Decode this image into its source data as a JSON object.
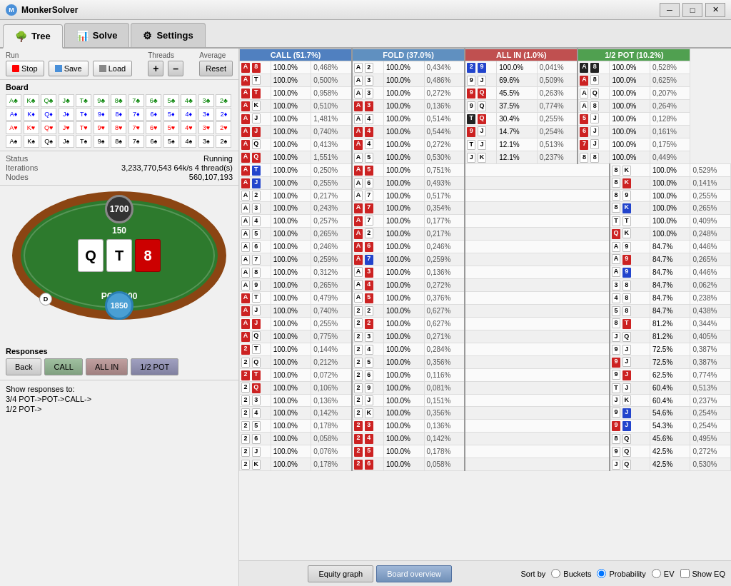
{
  "app": {
    "title": "MonkerSolver",
    "titlebar_icon": "M"
  },
  "tabs": [
    {
      "label": "Tree",
      "icon": "🌳",
      "active": true
    },
    {
      "label": "Solve",
      "icon": "📊",
      "active": false
    },
    {
      "label": "Settings",
      "icon": "⚙",
      "active": false
    }
  ],
  "run": {
    "label": "Run",
    "stop_label": "Stop",
    "save_label": "Save",
    "load_label": "Load",
    "threads_label": "Threads",
    "average_label": "Average",
    "reset_label": "Reset"
  },
  "board_label": "Board",
  "status": {
    "label": "Status",
    "running": "Running",
    "iterations_label": "Iterations",
    "iterations_value": "3,233,770,543  64k/s 4 thread(s)",
    "nodes_label": "Nodes",
    "nodes_value": "560,107,193"
  },
  "table": {
    "chip_top": "1700",
    "bet_middle": "150",
    "cards": [
      "Q",
      "T",
      "8"
    ],
    "pot": "POT: 300",
    "dealer": "D",
    "chip_bottom": "1850"
  },
  "responses": {
    "label": "Responses",
    "back_label": "Back",
    "call_label": "CALL",
    "allin_label": "ALL IN",
    "halfpot_label": "1/2 POT"
  },
  "show_responses_label": "Show responses to:",
  "show_responses_lines": [
    "3/4 POT->POT->CALL->",
    "1/2 POT->"
  ],
  "columns": {
    "call_header": "CALL (51.7%)",
    "fold_header": "FOLD (37.0%)",
    "allin_header": "ALL IN (1.0%)",
    "halfpot_header": "1/2 POT (10.2%)"
  },
  "strategy_rows": [
    {
      "h1": "A",
      "h1c": "red",
      "h2": "8",
      "h2c": "red",
      "cp": "100.0%",
      "cev": "0,468%",
      "h3": "A",
      "h3c": "white",
      "h4": "2",
      "h4c": "white",
      "fp": "100.0%",
      "fev": "0,434%",
      "h5": "2",
      "h5c": "blue",
      "h6": "9",
      "h6c": "blue",
      "ap": "100.0%",
      "aev": "0,041%",
      "h7": "A",
      "h7c": "black",
      "h8": "8",
      "h8c": "black",
      "hp": "100.0%",
      "hev": "0,528%"
    },
    {
      "h1": "A",
      "h1c": "red",
      "h2": "T",
      "h2c": "white",
      "cp": "100.0%",
      "cev": "0,500%",
      "h3": "A",
      "h3c": "white",
      "h4": "3",
      "h4c": "white",
      "fp": "100.0%",
      "fev": "0,486%",
      "h5": "9",
      "h5c": "white",
      "h6": "J",
      "h6c": "white",
      "ap": "69.6%",
      "aev": "0,509%",
      "h7": "A",
      "h7c": "red",
      "h8": "8",
      "h8c": "white",
      "hp": "100.0%",
      "hev": "0,625%"
    },
    {
      "h1": "A",
      "h1c": "red",
      "h2": "T",
      "h2c": "red",
      "cp": "100.0%",
      "cev": "0,958%",
      "h3": "A",
      "h3c": "white",
      "h4": "3",
      "h4c": "white",
      "fp": "100.0%",
      "fev": "0,272%",
      "h5": "9",
      "h5c": "red",
      "h6": "Q",
      "h6c": "red",
      "ap": "45.5%",
      "aev": "0,263%",
      "h7": "A",
      "h7c": "white",
      "h8": "Q",
      "h8c": "white",
      "hp": "100.0%",
      "hev": "0,207%"
    },
    {
      "h1": "A",
      "h1c": "red",
      "h2": "K",
      "h2c": "white",
      "cp": "100.0%",
      "cev": "0,510%",
      "h3": "A",
      "h3c": "red",
      "h4": "3",
      "h4c": "red",
      "fp": "100.0%",
      "fev": "0,136%",
      "h5": "9",
      "h5c": "white",
      "h6": "Q",
      "h6c": "white",
      "ap": "37.5%",
      "aev": "0,774%",
      "h7": "A",
      "h7c": "white",
      "h8": "8",
      "h8c": "white",
      "hp": "100.0%",
      "hev": "0,264%"
    },
    {
      "h1": "A",
      "h1c": "red",
      "h2": "J",
      "h2c": "white",
      "cp": "100.0%",
      "cev": "1,481%",
      "h3": "A",
      "h3c": "white",
      "h4": "4",
      "h4c": "white",
      "fp": "100.0%",
      "fev": "0,514%",
      "h5": "T",
      "h5c": "black",
      "h6": "Q",
      "h6c": "red",
      "ap": "30.4%",
      "aev": "0,255%",
      "h7": "5",
      "h7c": "red",
      "h8": "J",
      "h8c": "white",
      "hp": "100.0%",
      "hev": "0,128%"
    },
    {
      "h1": "A",
      "h1c": "red",
      "h2": "J",
      "h2c": "red",
      "cp": "100.0%",
      "cev": "0,740%",
      "h3": "A",
      "h3c": "red",
      "h4": "4",
      "h4c": "red",
      "fp": "100.0%",
      "fev": "0,544%",
      "h5": "9",
      "h5c": "red",
      "h6": "J",
      "h6c": "white",
      "ap": "14.7%",
      "aev": "0,254%",
      "h7": "6",
      "h7c": "red",
      "h8": "J",
      "h8c": "white",
      "hp": "100.0%",
      "hev": "0,161%"
    },
    {
      "h1": "A",
      "h1c": "red",
      "h2": "Q",
      "h2c": "white",
      "cp": "100.0%",
      "cev": "0,413%",
      "h3": "A",
      "h3c": "red",
      "h4": "4",
      "h4c": "white",
      "fp": "100.0%",
      "fev": "0,272%",
      "h5": "T",
      "h5c": "white",
      "h6": "J",
      "h6c": "white",
      "ap": "12.1%",
      "aev": "0,513%",
      "h7": "7",
      "h7c": "red",
      "h8": "J",
      "h8c": "white",
      "hp": "100.0%",
      "hev": "0,175%"
    },
    {
      "h1": "A",
      "h1c": "red",
      "h2": "Q",
      "h2c": "red",
      "cp": "100.0%",
      "cev": "1,551%",
      "h3": "A",
      "h3c": "white",
      "h4": "5",
      "h4c": "white",
      "fp": "100.0%",
      "fev": "0,530%",
      "h5": "J",
      "h5c": "white",
      "h6": "K",
      "h6c": "white",
      "ap": "12.1%",
      "aev": "0,237%",
      "h7": "8",
      "h7c": "white",
      "h8": "8",
      "h8c": "white",
      "hp": "100.0%",
      "hev": "0,449%"
    },
    {
      "h1": "A",
      "h1c": "red",
      "h2": "T",
      "h2c": "blue",
      "cp": "100.0%",
      "cev": "0,250%",
      "h3": "A",
      "h3c": "red",
      "h4": "5",
      "h4c": "red",
      "fp": "100.0%",
      "fev": "0,751%",
      "h5": "",
      "h5c": "",
      "h6": "",
      "h6c": "",
      "ap": "",
      "aev": "",
      "h7": "8",
      "h7c": "white",
      "h8": "K",
      "h8c": "white",
      "hp": "100.0%",
      "hev": "0,529%"
    },
    {
      "h1": "A",
      "h1c": "red",
      "h2": "J",
      "h2c": "blue",
      "cp": "100.0%",
      "cev": "0,255%",
      "h3": "A",
      "h3c": "white",
      "h4": "6",
      "h4c": "white",
      "fp": "100.0%",
      "fev": "0,493%",
      "h5": "",
      "h5c": "",
      "h6": "",
      "h6c": "",
      "ap": "",
      "aev": "",
      "h7": "8",
      "h7c": "white",
      "h8": "K",
      "h8c": "red",
      "hp": "100.0%",
      "hev": "0,141%"
    },
    {
      "h1": "A",
      "h1c": "white",
      "h2": "2",
      "h2c": "white",
      "cp": "100.0%",
      "cev": "0,217%",
      "h3": "A",
      "h3c": "white",
      "h4": "7",
      "h4c": "white",
      "fp": "100.0%",
      "fev": "0,517%",
      "h5": "",
      "h5c": "",
      "h6": "",
      "h6c": "",
      "ap": "",
      "aev": "",
      "h7": "8",
      "h7c": "white",
      "h8": "9",
      "h8c": "white",
      "hp": "100.0%",
      "hev": "0,255%"
    },
    {
      "h1": "A",
      "h1c": "white",
      "h2": "3",
      "h2c": "white",
      "cp": "100.0%",
      "cev": "0,243%",
      "h3": "A",
      "h3c": "red",
      "h4": "7",
      "h4c": "red",
      "fp": "100.0%",
      "fev": "0,354%",
      "h5": "",
      "h5c": "",
      "h6": "",
      "h6c": "",
      "ap": "",
      "aev": "",
      "h7": "8",
      "h7c": "white",
      "h8": "K",
      "h8c": "blue",
      "hp": "100.0%",
      "hev": "0,265%"
    },
    {
      "h1": "A",
      "h1c": "white",
      "h2": "4",
      "h2c": "white",
      "cp": "100.0%",
      "cev": "0,257%",
      "h3": "A",
      "h3c": "red",
      "h4": "7",
      "h4c": "white",
      "fp": "100.0%",
      "fev": "0,177%",
      "h5": "",
      "h5c": "",
      "h6": "",
      "h6c": "",
      "ap": "",
      "aev": "",
      "h7": "T",
      "h7c": "white",
      "h8": "T",
      "h8c": "white",
      "hp": "100.0%",
      "hev": "0,409%"
    },
    {
      "h1": "A",
      "h1c": "white",
      "h2": "5",
      "h2c": "white",
      "cp": "100.0%",
      "cev": "0,265%",
      "h3": "A",
      "h3c": "red",
      "h4": "2",
      "h4c": "white",
      "fp": "100.0%",
      "fev": "0,217%",
      "h5": "",
      "h5c": "",
      "h6": "",
      "h6c": "",
      "ap": "",
      "aev": "",
      "h7": "Q",
      "h7c": "red",
      "h8": "K",
      "h8c": "white",
      "hp": "100.0%",
      "hev": "0,248%"
    },
    {
      "h1": "A",
      "h1c": "white",
      "h2": "6",
      "h2c": "white",
      "cp": "100.0%",
      "cev": "0,246%",
      "h3": "A",
      "h3c": "red",
      "h4": "6",
      "h4c": "red",
      "fp": "100.0%",
      "fev": "0,246%",
      "h5": "",
      "h5c": "",
      "h6": "",
      "h6c": "",
      "ap": "",
      "aev": "",
      "h7": "A",
      "h7c": "white",
      "h8": "9",
      "h8c": "white",
      "hp": "84.7%",
      "hev": "0,446%"
    },
    {
      "h1": "A",
      "h1c": "white",
      "h2": "7",
      "h2c": "white",
      "cp": "100.0%",
      "cev": "0,259%",
      "h3": "A",
      "h3c": "red",
      "h4": "7",
      "h4c": "blue",
      "fp": "100.0%",
      "fev": "0,259%",
      "h5": "",
      "h5c": "",
      "h6": "",
      "h6c": "",
      "ap": "",
      "aev": "",
      "h7": "A",
      "h7c": "white",
      "h8": "9",
      "h8c": "red",
      "hp": "84.7%",
      "hev": "0,265%"
    },
    {
      "h1": "A",
      "h1c": "white",
      "h2": "8",
      "h2c": "white",
      "cp": "100.0%",
      "cev": "0,312%",
      "h3": "A",
      "h3c": "white",
      "h4": "3",
      "h4c": "red",
      "fp": "100.0%",
      "fev": "0,136%",
      "h5": "",
      "h5c": "",
      "h6": "",
      "h6c": "",
      "ap": "",
      "aev": "",
      "h7": "A",
      "h7c": "white",
      "h8": "9",
      "h8c": "blue",
      "hp": "84.7%",
      "hev": "0,446%"
    },
    {
      "h1": "A",
      "h1c": "white",
      "h2": "9",
      "h2c": "white",
      "cp": "100.0%",
      "cev": "0,265%",
      "h3": "A",
      "h3c": "white",
      "h4": "4",
      "h4c": "red",
      "fp": "100.0%",
      "fev": "0,272%",
      "h5": "",
      "h5c": "",
      "h6": "",
      "h6c": "",
      "ap": "",
      "aev": "",
      "h7": "3",
      "h7c": "white",
      "h8": "8",
      "h8c": "white",
      "hp": "84.7%",
      "hev": "0,062%"
    },
    {
      "h1": "A",
      "h1c": "red",
      "h2": "T",
      "h2c": "white",
      "cp": "100.0%",
      "cev": "0,479%",
      "h3": "A",
      "h3c": "white",
      "h4": "5",
      "h4c": "red",
      "fp": "100.0%",
      "fev": "0,376%",
      "h5": "",
      "h5c": "",
      "h6": "",
      "h6c": "",
      "ap": "",
      "aev": "",
      "h7": "4",
      "h7c": "white",
      "h8": "8",
      "h8c": "white",
      "hp": "84.7%",
      "hev": "0,238%"
    },
    {
      "h1": "A",
      "h1c": "red",
      "h2": "J",
      "h2c": "white",
      "cp": "100.0%",
      "cev": "0,740%",
      "h3": "2",
      "h3c": "white",
      "h4": "2",
      "h4c": "white",
      "fp": "100.0%",
      "fev": "0,627%",
      "h5": "",
      "h5c": "",
      "h6": "",
      "h6c": "",
      "ap": "",
      "aev": "",
      "h7": "5",
      "h7c": "white",
      "h8": "8",
      "h8c": "white",
      "hp": "84.7%",
      "hev": "0,438%"
    },
    {
      "h1": "A",
      "h1c": "red",
      "h2": "J",
      "h2c": "red",
      "cp": "100.0%",
      "cev": "0,255%",
      "h3": "2",
      "h3c": "white",
      "h4": "2",
      "h4c": "red",
      "fp": "100.0%",
      "fev": "0,627%",
      "h5": "",
      "h5c": "",
      "h6": "",
      "h6c": "",
      "ap": "",
      "aev": "",
      "h7": "8",
      "h7c": "white",
      "h8": "T",
      "h8c": "red",
      "hp": "81.2%",
      "hev": "0,344%"
    },
    {
      "h1": "A",
      "h1c": "red",
      "h2": "Q",
      "h2c": "white",
      "cp": "100.0%",
      "cev": "0,775%",
      "h3": "2",
      "h3c": "white",
      "h4": "3",
      "h4c": "white",
      "fp": "100.0%",
      "fev": "0,271%",
      "h5": "",
      "h5c": "",
      "h6": "",
      "h6c": "",
      "ap": "",
      "aev": "",
      "h7": "J",
      "h7c": "white",
      "h8": "Q",
      "h8c": "white",
      "hp": "81.2%",
      "hev": "0,405%"
    },
    {
      "h1": "2",
      "h1c": "red",
      "h2": "T",
      "h2c": "white",
      "cp": "100.0%",
      "cev": "0,144%",
      "h3": "2",
      "h3c": "white",
      "h4": "4",
      "h4c": "white",
      "fp": "100.0%",
      "fev": "0,284%",
      "h5": "",
      "h5c": "",
      "h6": "",
      "h6c": "",
      "ap": "",
      "aev": "",
      "h7": "9",
      "h7c": "white",
      "h8": "J",
      "h8c": "white",
      "hp": "72.5%",
      "hev": "0,387%"
    },
    {
      "h1": "2",
      "h1c": "white",
      "h2": "Q",
      "h2c": "white",
      "cp": "100.0%",
      "cev": "0,212%",
      "h3": "2",
      "h3c": "white",
      "h4": "5",
      "h4c": "white",
      "fp": "100.0%",
      "fev": "0,356%",
      "h5": "",
      "h5c": "",
      "h6": "",
      "h6c": "",
      "ap": "",
      "aev": "",
      "h7": "9",
      "h7c": "red",
      "h8": "J",
      "h8c": "white",
      "hp": "72.5%",
      "hev": "0,387%"
    },
    {
      "h1": "2",
      "h1c": "red",
      "h2": "T",
      "h2c": "red",
      "cp": "100.0%",
      "cev": "0,072%",
      "h3": "2",
      "h3c": "white",
      "h4": "6",
      "h4c": "white",
      "fp": "100.0%",
      "fev": "0,116%",
      "h5": "",
      "h5c": "",
      "h6": "",
      "h6c": "",
      "ap": "",
      "aev": "",
      "h7": "9",
      "h7c": "white",
      "h8": "J",
      "h8c": "red",
      "hp": "62.5%",
      "hev": "0,774%"
    },
    {
      "h1": "2",
      "h1c": "white",
      "h2": "Q",
      "h2c": "red",
      "cp": "100.0%",
      "cev": "0,106%",
      "h3": "2",
      "h3c": "white",
      "h4": "9",
      "h4c": "white",
      "fp": "100.0%",
      "fev": "0,081%",
      "h5": "",
      "h5c": "",
      "h6": "",
      "h6c": "",
      "ap": "",
      "aev": "",
      "h7": "T",
      "h7c": "white",
      "h8": "J",
      "h8c": "white",
      "hp": "60.4%",
      "hev": "0,513%"
    },
    {
      "h1": "2",
      "h1c": "white",
      "h2": "3",
      "h2c": "white",
      "cp": "100.0%",
      "cev": "0,136%",
      "h3": "2",
      "h3c": "white",
      "h4": "J",
      "h4c": "white",
      "fp": "100.0%",
      "fev": "0,151%",
      "h5": "",
      "h5c": "",
      "h6": "",
      "h6c": "",
      "ap": "",
      "aev": "",
      "h7": "J",
      "h7c": "white",
      "h8": "K",
      "h8c": "white",
      "hp": "60.4%",
      "hev": "0,237%"
    },
    {
      "h1": "2",
      "h1c": "white",
      "h2": "4",
      "h2c": "white",
      "cp": "100.0%",
      "cev": "0,142%",
      "h3": "2",
      "h3c": "white",
      "h4": "K",
      "h4c": "white",
      "fp": "100.0%",
      "fev": "0,356%",
      "h5": "",
      "h5c": "",
      "h6": "",
      "h6c": "",
      "ap": "",
      "aev": "",
      "h7": "9",
      "h7c": "white",
      "h8": "J",
      "h8c": "blue",
      "hp": "54.6%",
      "hev": "0,254%"
    },
    {
      "h1": "2",
      "h1c": "white",
      "h2": "5",
      "h2c": "white",
      "cp": "100.0%",
      "cev": "0,178%",
      "h3": "2",
      "h3c": "red",
      "h4": "3",
      "h4c": "red",
      "fp": "100.0%",
      "fev": "0,136%",
      "h5": "",
      "h5c": "",
      "h6": "",
      "h6c": "",
      "ap": "",
      "aev": "",
      "h7": "9",
      "h7c": "red",
      "h8": "J",
      "h8c": "blue",
      "hp": "54.3%",
      "hev": "0,254%"
    },
    {
      "h1": "2",
      "h1c": "white",
      "h2": "6",
      "h2c": "white",
      "cp": "100.0%",
      "cev": "0,058%",
      "h3": "2",
      "h3c": "red",
      "h4": "4",
      "h4c": "red",
      "fp": "100.0%",
      "fev": "0,142%",
      "h5": "",
      "h5c": "",
      "h6": "",
      "h6c": "",
      "ap": "",
      "aev": "",
      "h7": "8",
      "h7c": "white",
      "h8": "Q",
      "h8c": "white",
      "hp": "45.6%",
      "hev": "0,495%"
    },
    {
      "h1": "2",
      "h1c": "white",
      "h2": "J",
      "h2c": "white",
      "cp": "100.0%",
      "cev": "0,076%",
      "h3": "2",
      "h3c": "red",
      "h4": "5",
      "h4c": "red",
      "fp": "100.0%",
      "fev": "0,178%",
      "h5": "",
      "h5c": "",
      "h6": "",
      "h6c": "",
      "ap": "",
      "aev": "",
      "h7": "9",
      "h7c": "white",
      "h8": "Q",
      "h8c": "white",
      "hp": "42.5%",
      "hev": "0,272%"
    },
    {
      "h1": "2",
      "h1c": "white",
      "h2": "K",
      "h2c": "white",
      "cp": "100.0%",
      "cev": "0,178%",
      "h3": "2",
      "h3c": "red",
      "h4": "6",
      "h4c": "red",
      "fp": "100.0%",
      "fev": "0,058%",
      "h5": "",
      "h5c": "",
      "h6": "",
      "h6c": "",
      "ap": "",
      "aev": "",
      "h7": "J",
      "h7c": "white",
      "h8": "Q",
      "h8c": "white",
      "hp": "42.5%",
      "hev": "0,530%"
    }
  ],
  "bottom": {
    "equity_graph_label": "Equity graph",
    "board_overview_label": "Board overview",
    "sort_by_label": "Sort by",
    "buckets_label": "Buckets",
    "probability_label": "Probability",
    "ev_label": "EV",
    "show_eq_label": "Show EQ"
  }
}
